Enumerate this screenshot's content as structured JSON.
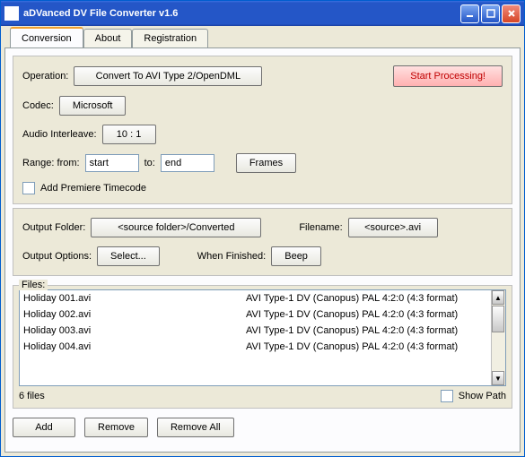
{
  "window": {
    "title": "aDVanced DV File Converter v1.6"
  },
  "tabs": {
    "conversion": "Conversion",
    "about": "About",
    "registration": "Registration"
  },
  "panel1": {
    "operation_label": "Operation:",
    "operation_button": "Convert To AVI Type 2/OpenDML",
    "start_button": "Start Processing!",
    "codec_label": "Codec:",
    "codec_button": "Microsoft",
    "interleave_label": "Audio Interleave:",
    "interleave_button": "10 : 1",
    "range_label": "Range: from:",
    "range_start": "start",
    "range_to": "to:",
    "range_end": "end",
    "frames_button": "Frames",
    "timecode_label": "Add Premiere Timecode"
  },
  "panel2": {
    "output_folder_label": "Output Folder:",
    "output_folder_button": "<source folder>/Converted",
    "filename_label": "Filename:",
    "filename_button": "<source>.avi",
    "output_options_label": "Output Options:",
    "select_button": "Select...",
    "when_finished_label": "When Finished:",
    "beep_button": "Beep"
  },
  "files": {
    "label": "Files:",
    "rows": [
      {
        "name": "Holiday 001.avi",
        "desc": "AVI Type-1 DV (Canopus) PAL 4:2:0 (4:3 format)"
      },
      {
        "name": "Holiday 002.avi",
        "desc": "AVI Type-1 DV (Canopus) PAL 4:2:0 (4:3 format)"
      },
      {
        "name": "Holiday 003.avi",
        "desc": "AVI Type-1 DV (Canopus) PAL 4:2:0 (4:3 format)"
      },
      {
        "name": "Holiday 004.avi",
        "desc": "AVI Type-1 DV (Canopus) PAL 4:2:0 (4:3 format)"
      }
    ],
    "count": "6 files",
    "show_path": "Show Path"
  },
  "actions": {
    "add": "Add",
    "remove": "Remove",
    "remove_all": "Remove All"
  }
}
